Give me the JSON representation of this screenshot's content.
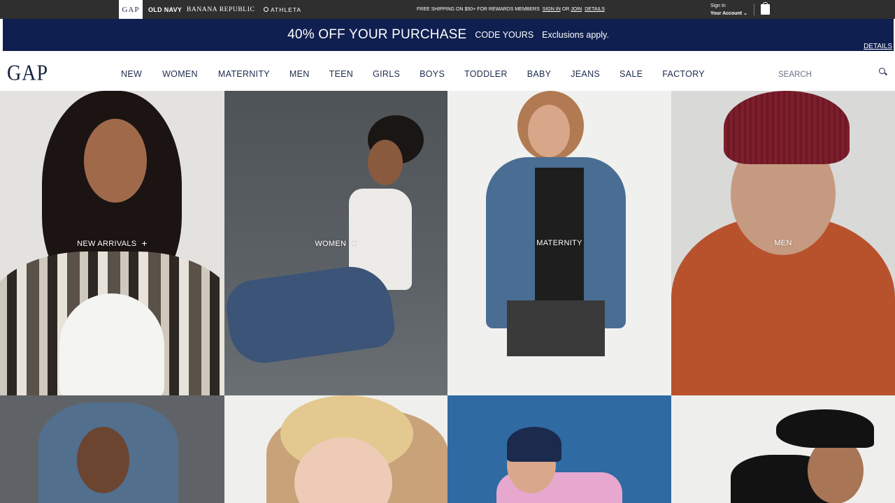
{
  "topbar": {
    "brands": [
      "GAP",
      "OLD NAVY",
      "BANANA REPUBLIC",
      "ATHLETA"
    ],
    "shipping": {
      "text": "FREE SHIPPING ON $50+ FOR REWARDS MEMBERS",
      "sign_in": "SIGN IN",
      "or": "OR",
      "join": "JOIN",
      "details": "DETAILS"
    },
    "account": {
      "sign_in": "Sign In",
      "your_account": "Your Account"
    }
  },
  "promo": {
    "headline": "40% OFF YOUR PURCHASE",
    "code": "CODE YOURS",
    "exclusions": "Exclusions apply.",
    "details": "DETAILS"
  },
  "nav": {
    "logo": "GAP",
    "items": [
      "NEW",
      "WOMEN",
      "MATERNITY",
      "MEN",
      "TEEN",
      "GIRLS",
      "BOYS",
      "TODDLER",
      "BABY",
      "JEANS",
      "SALE",
      "FACTORY"
    ],
    "search_placeholder": "SEARCH"
  },
  "tiles": [
    {
      "label": "NEW ARRIVALS",
      "has_plus": true
    },
    {
      "label": "WOMEN",
      "has_plus": true
    },
    {
      "label": "MATERNITY",
      "has_plus": false
    },
    {
      "label": "MEN",
      "has_plus": false
    }
  ],
  "colors": {
    "topbar": "#2f2f2f",
    "promo_bg": "#0f1f4f",
    "nav_text": "#1d2b4d"
  }
}
